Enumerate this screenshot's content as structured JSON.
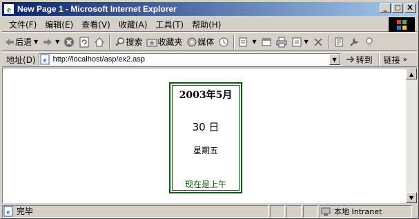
{
  "window": {
    "title": "New Page 1 - Microsoft Internet Explorer",
    "buttons": {
      "minimize": "_",
      "maximize": "□",
      "close": "X"
    }
  },
  "menu": {
    "items": [
      "文件(F)",
      "编辑(E)",
      "查看(V)",
      "收藏(A)",
      "工具(T)",
      "帮助(H)"
    ]
  },
  "toolbar": {
    "back": "后退",
    "search": "搜索",
    "favorites": "收藏夹",
    "media": "媒体"
  },
  "address": {
    "label": "地址(D)",
    "url": "http://localhost/asp/ex2.asp",
    "go": "转到",
    "links": "链接"
  },
  "calendar": {
    "year_month": "2003年5月",
    "day": "30 日",
    "weekday": "星期五",
    "ampm": "现在是上午"
  },
  "status": {
    "text": "完毕",
    "zone": "本地 Intranet"
  },
  "colors": {
    "titlebar_start": "#0a246a",
    "titlebar_end": "#a6caf0",
    "calendar_border": "#006400"
  }
}
